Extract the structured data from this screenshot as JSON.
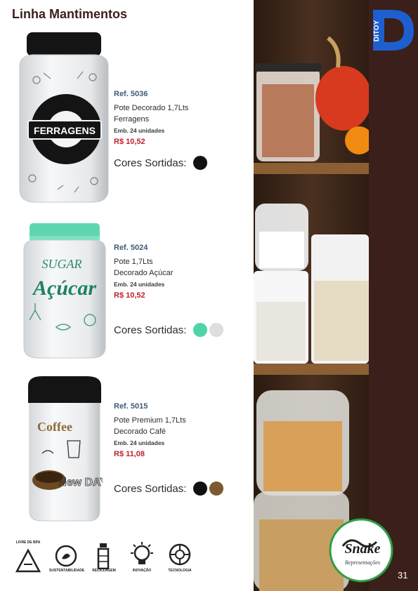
{
  "page": {
    "title": "Linha Mantimentos",
    "page_number": "31"
  },
  "products": [
    {
      "ref": "Ref. 5036",
      "name_line1": "Pote Decorado 1,7Lts",
      "name_line2": "Ferragens",
      "emb": "Emb. 24 unidades",
      "price": "R$ 10,52",
      "colors_label": "Cores Sortidas:",
      "jar_text": "FERRAGENS",
      "colors": [
        "#111111"
      ]
    },
    {
      "ref": "Ref. 5024",
      "name_line1": "Pote 1,7Lts",
      "name_line2": "Decorado Açúcar",
      "emb": "Emb. 24 unidades",
      "price": "R$ 10,52",
      "colors_label": "Cores Sortidas:",
      "jar_text_top": "SUGAR",
      "jar_text": "Açúcar",
      "colors": [
        "#4fd4a5",
        "#dedede"
      ]
    },
    {
      "ref": "Ref. 5015",
      "name_line1": "Pote Premium 1,7Lts",
      "name_line2": "Decorado Café",
      "emb": "Emb. 24 unidades",
      "price": "R$ 11,08",
      "colors_label": "Cores Sortidas:",
      "jar_text_top": "Coffee",
      "jar_text": "New DAY",
      "colors": [
        "#111111",
        "#7a5a2e"
      ]
    }
  ],
  "brand": {
    "logo_text": "DITOY"
  },
  "badge": {
    "line1": "Snake",
    "line2": "Representações"
  },
  "icons": [
    {
      "icon": "recycle-triangle-icon",
      "caption": "LIVRE DE BPA"
    },
    {
      "icon": "sustainability-icon",
      "caption": "SUSTENTABILIDADE"
    },
    {
      "icon": "recycling-bottle-icon",
      "caption": "RECICLAGEM"
    },
    {
      "icon": "innovation-bulb-icon",
      "caption": "INOVAÇÃO"
    },
    {
      "icon": "technology-chip-icon",
      "caption": "TECNOLOGIA"
    }
  ]
}
